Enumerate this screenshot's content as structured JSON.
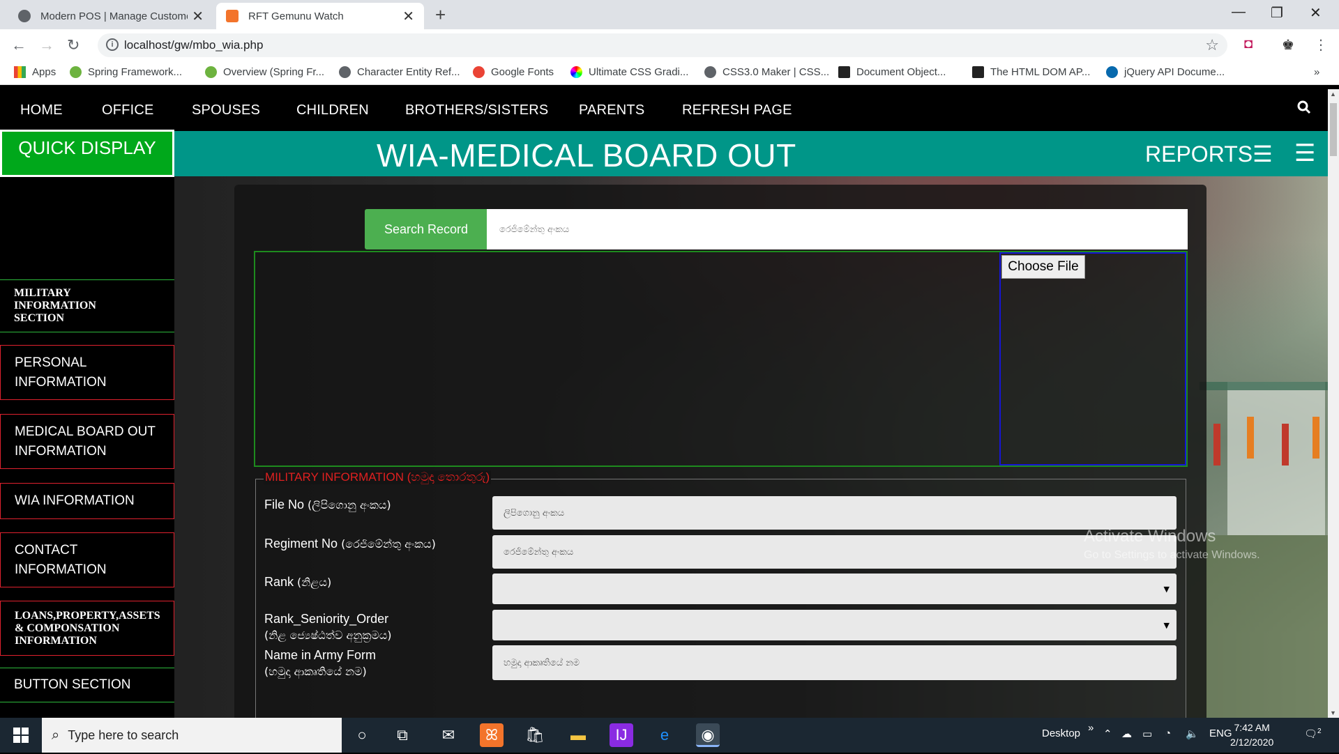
{
  "browser": {
    "tabs": [
      {
        "title": "Modern POS | Manage Customer",
        "close": "✕"
      },
      {
        "title": "RFT Gemunu Watch",
        "close": "✕"
      }
    ],
    "new_tab": "+",
    "window_controls": [
      "—",
      "❐",
      "✕"
    ],
    "url": "localhost/gw/mbo_wia.php",
    "bookmarks": [
      "Apps",
      "Spring Framework...",
      "Overview (Spring Fr...",
      "Character Entity Ref...",
      "Google Fonts",
      "Ultimate CSS Gradi...",
      "CSS3.0 Maker | CSS...",
      "Document Object...",
      "The HTML DOM AP...",
      "jQuery API Docume..."
    ],
    "bookmarks_more": "»"
  },
  "nav": {
    "items": [
      "HOME",
      "OFFICE",
      "SPOUSES",
      "CHILDREN",
      "BROTHERS/SISTERS",
      "PARENTS",
      "REFRESH PAGE"
    ],
    "search_icon": "🔍"
  },
  "header": {
    "quick_display": "QUICK DISPLAY",
    "title": "WIA-MEDICAL BOARD OUT",
    "reports": "REPORTS☰",
    "menu_icon": "☰"
  },
  "sidebar": {
    "items": [
      {
        "line1": "MILITARY",
        "line2": "INFORMATION",
        "line3": "SECTION"
      },
      {
        "line1": "PERSONAL",
        "line2": "INFORMATION"
      },
      {
        "line1": "MEDICAL BOARD OUT",
        "line2": "INFORMATION"
      },
      {
        "line1": "WIA INFORMATION"
      },
      {
        "line1": "CONTACT",
        "line2": "INFORMATION"
      },
      {
        "line1": "LOANS,PROPERTY,ASSETS",
        "line2": "& COMPONSATION",
        "line3": "INFORMATION"
      },
      {
        "line1": "BUTTON SECTION"
      }
    ]
  },
  "search": {
    "button": "Search Record",
    "placeholder": "රෙජිමේන්තු අංකය"
  },
  "upload": {
    "choose_file": "Choose File"
  },
  "form": {
    "legend": "MILITARY INFORMATION (හමුදා තොරතුරු)",
    "fields": [
      {
        "label": "File No",
        "label_si": "(ලිපිගොනු අංකය)",
        "placeholder": "ලිපිගොනු අංකය"
      },
      {
        "label": "Regiment No",
        "label_si": "(රෙජිමේන්තු අංකය)",
        "placeholder": "රෙජිමේන්තු අංකය"
      },
      {
        "label": "Rank",
        "label_si": "(නිළය)",
        "placeholder": ""
      },
      {
        "label": "Rank_Seniority_Order",
        "label_si": "(නිළ ජ්‍යෙෂ්ඨත්ව අනුක්‍රමය)",
        "placeholder": ""
      },
      {
        "label": "Name in Army Form",
        "label_si": "(හමුදා ආකෘතියේ නම)",
        "placeholder": "හමුදා ආකෘතියේ නම"
      }
    ],
    "select_arrow": "▼"
  },
  "watermark": {
    "line1": "Activate Windows",
    "line2": "Go to Settings to activate Windows."
  },
  "taskbar": {
    "search_placeholder": "Type here to search",
    "desktop": "Desktop",
    "lang": "ENG",
    "time": "7:42 AM",
    "date": "2/12/2020",
    "notifications": "2"
  }
}
